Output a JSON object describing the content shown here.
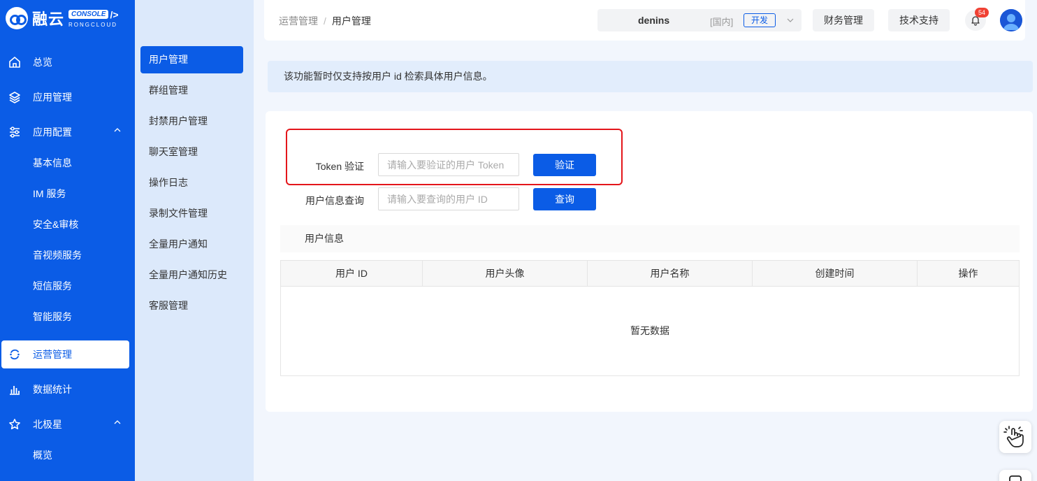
{
  "logo": {
    "text": "融云",
    "badge": "CONSOLE",
    "slash": "/>",
    "sub": "RONGCLOUD"
  },
  "sidebar": {
    "items": [
      {
        "label": "总览",
        "icon": "home-icon"
      },
      {
        "label": "应用管理",
        "icon": "layers-icon"
      },
      {
        "label": "应用配置",
        "icon": "sliders-icon"
      },
      {
        "label": "运营管理",
        "icon": "refresh-icon"
      },
      {
        "label": "数据统计",
        "icon": "bar-chart-icon"
      },
      {
        "label": "北极星",
        "icon": "star-icon"
      }
    ],
    "config_children": [
      "基本信息",
      "IM 服务",
      "安全&审核",
      "音视频服务",
      "短信服务",
      "智能服务"
    ],
    "polaris_children": [
      "概览"
    ]
  },
  "submenu": {
    "items": [
      "用户管理",
      "群组管理",
      "封禁用户管理",
      "聊天室管理",
      "操作日志",
      "录制文件管理",
      "全量用户通知",
      "全量用户通知历史",
      "客服管理"
    ]
  },
  "header": {
    "breadcrumb": [
      "运营管理",
      "用户管理"
    ],
    "breadcrumb_sep": "/",
    "user": "denins",
    "region": "[国内]",
    "env": "开发",
    "finance": "财务管理",
    "support": "技术支持",
    "notifications": "54"
  },
  "notice": "该功能暂时仅支持按用户 id 检索具体用户信息。",
  "form": {
    "token_label": "Token 验证",
    "token_placeholder": "请输入要验证的用户 Token",
    "verify_button": "验证",
    "query_label": "用户信息查询",
    "query_placeholder": "请输入要查询的用户 ID",
    "query_button": "查询"
  },
  "section_title": "用户信息",
  "table": {
    "columns": [
      "用户 ID",
      "用户头像",
      "用户名称",
      "创建时间",
      "操作"
    ],
    "empty_text": "暂无数据"
  },
  "colors": {
    "primary": "#0b5ce6",
    "highlight": "#e4161b",
    "badge": "#f04134"
  }
}
